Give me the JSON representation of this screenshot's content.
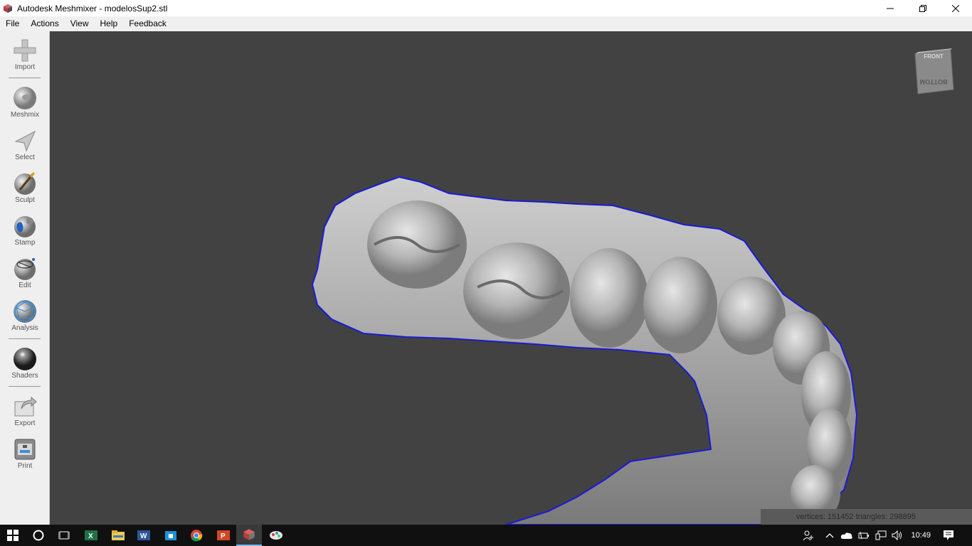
{
  "window": {
    "title": "Autodesk Meshmixer - modelosSup2.stl"
  },
  "menu": [
    "File",
    "Actions",
    "View",
    "Help",
    "Feedback"
  ],
  "toolbar": {
    "import": "Import",
    "meshmix": "Meshmix",
    "select": "Select",
    "sculpt": "Sculpt",
    "stamp": "Stamp",
    "edit": "Edit",
    "analysis": "Analysis",
    "shaders": "Shaders",
    "export": "Export",
    "print": "Print"
  },
  "viewcube": {
    "front": "FRONT",
    "bottom": "BOTTOM"
  },
  "status": {
    "stats": "vertices: 151452 triangles: 298895"
  },
  "taskbar": {
    "clock": "10:49"
  },
  "colors": {
    "viewport_bg": "#424242",
    "mesh": "#a8a8a8",
    "boundary": "#1a1ad8",
    "toolbar_bg": "#f0efef"
  }
}
